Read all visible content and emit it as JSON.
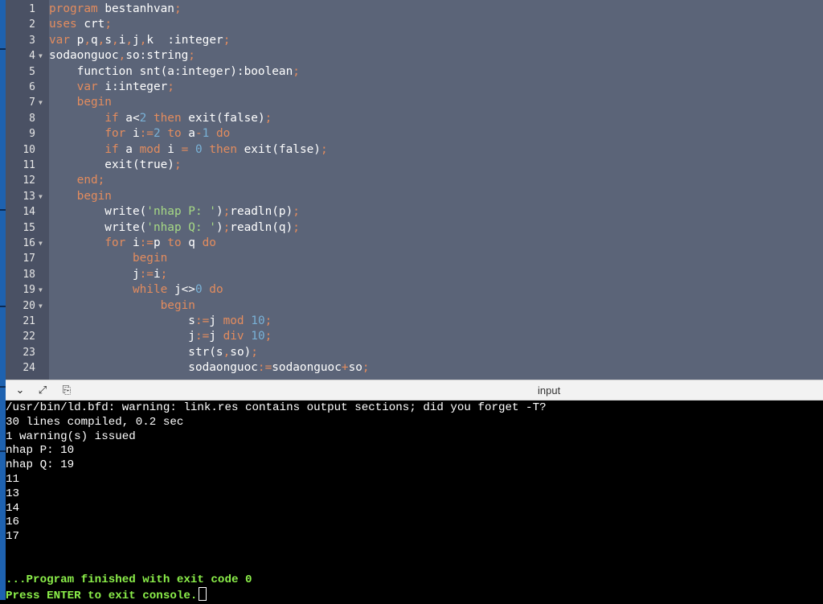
{
  "editor": {
    "lines": [
      {
        "n": "1",
        "fold": false,
        "tokens": [
          [
            "program",
            "k"
          ],
          [
            " bestanhvan",
            ""
          ],
          [
            ";",
            "p"
          ]
        ]
      },
      {
        "n": "2",
        "fold": false,
        "tokens": [
          [
            "uses",
            "k"
          ],
          [
            " crt",
            ""
          ],
          [
            ";",
            "p"
          ]
        ]
      },
      {
        "n": "3",
        "fold": false,
        "tokens": [
          [
            "var",
            "k"
          ],
          [
            " p",
            ""
          ],
          [
            ",",
            "p"
          ],
          [
            "q",
            ""
          ],
          [
            ",",
            "p"
          ],
          [
            "s",
            ""
          ],
          [
            ",",
            "p"
          ],
          [
            "i",
            ""
          ],
          [
            ",",
            "p"
          ],
          [
            "j",
            ""
          ],
          [
            ",",
            "p"
          ],
          [
            "k  :integer",
            ""
          ],
          [
            ";",
            "p"
          ]
        ]
      },
      {
        "n": "4",
        "fold": true,
        "tokens": [
          [
            "sodaonguoc",
            ""
          ],
          [
            ",",
            "p"
          ],
          [
            "so:string",
            ""
          ],
          [
            ";",
            "p"
          ]
        ]
      },
      {
        "n": "5",
        "fold": false,
        "tokens": [
          [
            "    function snt(a:integer):boolean",
            ""
          ],
          [
            ";",
            "p"
          ]
        ]
      },
      {
        "n": "6",
        "fold": false,
        "tokens": [
          [
            "    ",
            ""
          ],
          [
            "var",
            "k"
          ],
          [
            " i:integer",
            ""
          ],
          [
            ";",
            "p"
          ]
        ]
      },
      {
        "n": "7",
        "fold": true,
        "tokens": [
          [
            "    ",
            ""
          ],
          [
            "begin",
            "k"
          ]
        ]
      },
      {
        "n": "8",
        "fold": false,
        "tokens": [
          [
            "        ",
            ""
          ],
          [
            "if",
            "k"
          ],
          [
            " a<",
            ""
          ],
          [
            "2",
            "n"
          ],
          [
            " ",
            ""
          ],
          [
            "then",
            "k"
          ],
          [
            " exit(false)",
            ""
          ],
          [
            ";",
            "p"
          ]
        ]
      },
      {
        "n": "9",
        "fold": false,
        "tokens": [
          [
            "        ",
            ""
          ],
          [
            "for",
            "k"
          ],
          [
            " i",
            ""
          ],
          [
            ":=",
            "p"
          ],
          [
            "2",
            "n"
          ],
          [
            " ",
            ""
          ],
          [
            "to",
            "k"
          ],
          [
            " a",
            ""
          ],
          [
            "-",
            "p"
          ],
          [
            "1",
            "n"
          ],
          [
            " ",
            ""
          ],
          [
            "do",
            "k"
          ]
        ]
      },
      {
        "n": "10",
        "fold": false,
        "tokens": [
          [
            "        ",
            ""
          ],
          [
            "if",
            "k"
          ],
          [
            " a ",
            ""
          ],
          [
            "mod",
            "k"
          ],
          [
            " i ",
            ""
          ],
          [
            "=",
            "p"
          ],
          [
            " ",
            ""
          ],
          [
            "0",
            "n"
          ],
          [
            " ",
            ""
          ],
          [
            "then",
            "k"
          ],
          [
            " exit(false)",
            ""
          ],
          [
            ";",
            "p"
          ]
        ]
      },
      {
        "n": "11",
        "fold": false,
        "tokens": [
          [
            "        exit(true)",
            ""
          ],
          [
            ";",
            "p"
          ]
        ]
      },
      {
        "n": "12",
        "fold": false,
        "tokens": [
          [
            "    ",
            ""
          ],
          [
            "end",
            "k"
          ],
          [
            ";",
            "p"
          ]
        ]
      },
      {
        "n": "13",
        "fold": true,
        "tokens": [
          [
            "    ",
            ""
          ],
          [
            "begin",
            "k"
          ]
        ]
      },
      {
        "n": "14",
        "fold": false,
        "tokens": [
          [
            "        write(",
            ""
          ],
          [
            "'nhap P: '",
            "s"
          ],
          [
            ")",
            ""
          ],
          [
            ";",
            "p"
          ],
          [
            "readln(p)",
            ""
          ],
          [
            ";",
            "p"
          ]
        ]
      },
      {
        "n": "15",
        "fold": false,
        "tokens": [
          [
            "        write(",
            ""
          ],
          [
            "'nhap Q: '",
            "s"
          ],
          [
            ")",
            ""
          ],
          [
            ";",
            "p"
          ],
          [
            "readln(q)",
            ""
          ],
          [
            ";",
            "p"
          ]
        ]
      },
      {
        "n": "16",
        "fold": true,
        "tokens": [
          [
            "        ",
            ""
          ],
          [
            "for",
            "k"
          ],
          [
            " i",
            ""
          ],
          [
            ":=",
            "p"
          ],
          [
            "p ",
            ""
          ],
          [
            "to",
            "k"
          ],
          [
            " q ",
            ""
          ],
          [
            "do",
            "k"
          ]
        ]
      },
      {
        "n": "17",
        "fold": false,
        "tokens": [
          [
            "            ",
            ""
          ],
          [
            "begin",
            "k"
          ]
        ]
      },
      {
        "n": "18",
        "fold": false,
        "tokens": [
          [
            "            j",
            ""
          ],
          [
            ":=",
            "p"
          ],
          [
            "i",
            ""
          ],
          [
            ";",
            "p"
          ]
        ]
      },
      {
        "n": "19",
        "fold": true,
        "tokens": [
          [
            "            ",
            ""
          ],
          [
            "while",
            "k"
          ],
          [
            " j<>",
            ""
          ],
          [
            "0",
            "n"
          ],
          [
            " ",
            ""
          ],
          [
            "do",
            "k"
          ]
        ]
      },
      {
        "n": "20",
        "fold": true,
        "tokens": [
          [
            "                ",
            ""
          ],
          [
            "begin",
            "k"
          ]
        ]
      },
      {
        "n": "21",
        "fold": false,
        "tokens": [
          [
            "                    s",
            ""
          ],
          [
            ":=",
            "p"
          ],
          [
            "j ",
            ""
          ],
          [
            "mod",
            "k"
          ],
          [
            " ",
            ""
          ],
          [
            "10",
            "n"
          ],
          [
            ";",
            "p"
          ]
        ]
      },
      {
        "n": "22",
        "fold": false,
        "tokens": [
          [
            "                    j",
            ""
          ],
          [
            ":=",
            "p"
          ],
          [
            "j ",
            ""
          ],
          [
            "div",
            "k"
          ],
          [
            " ",
            ""
          ],
          [
            "10",
            "n"
          ],
          [
            ";",
            "p"
          ]
        ]
      },
      {
        "n": "23",
        "fold": false,
        "tokens": [
          [
            "                    str(s",
            ""
          ],
          [
            ",",
            "p"
          ],
          [
            "so)",
            ""
          ],
          [
            ";",
            "p"
          ]
        ]
      },
      {
        "n": "24",
        "fold": false,
        "tokens": [
          [
            "                    sodaonguoc",
            ""
          ],
          [
            ":=",
            "p"
          ],
          [
            "sodaonguoc",
            ""
          ],
          [
            "+",
            "p"
          ],
          [
            "so",
            ""
          ],
          [
            ";",
            "p"
          ]
        ]
      }
    ]
  },
  "toolbar": {
    "collapse_icon": "chevron-down-icon",
    "expand_icon": "expand-icon",
    "copy_icon": "clipboard-icon",
    "collapse_glyph": "⌄",
    "expand_glyph": "⤢",
    "copy_glyph": "⎘",
    "label": "input"
  },
  "console": {
    "lines": [
      {
        "text": "/usr/bin/ld.bfd: warning: link.res contains output sections; did you forget -T?",
        "style": ""
      },
      {
        "text": "30 lines compiled, 0.2 sec",
        "style": ""
      },
      {
        "text": "1 warning(s) issued",
        "style": ""
      },
      {
        "text": "nhap P: 10",
        "style": ""
      },
      {
        "text": "nhap Q: 19",
        "style": ""
      },
      {
        "text": "11",
        "style": ""
      },
      {
        "text": "13",
        "style": ""
      },
      {
        "text": "14",
        "style": ""
      },
      {
        "text": "16",
        "style": ""
      },
      {
        "text": "17",
        "style": ""
      },
      {
        "text": "",
        "style": ""
      },
      {
        "text": "",
        "style": ""
      },
      {
        "text": "...Program finished with exit code 0",
        "style": "green"
      },
      {
        "text": "Press ENTER to exit console.",
        "style": "green",
        "cursor": true
      }
    ]
  },
  "colors": {
    "editor_bg": "#5b6478",
    "gutter_bg": "#4a5164",
    "keyword": "#e38c5e",
    "number": "#79b1d6",
    "string": "#a6d985",
    "console_green": "#8cf04a"
  }
}
